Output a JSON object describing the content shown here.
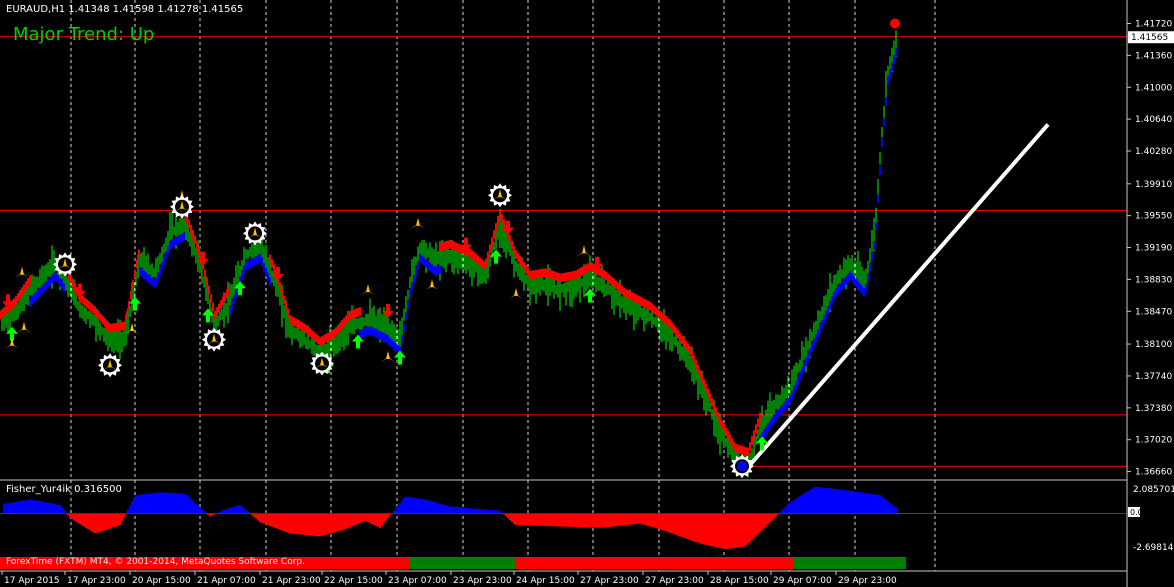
{
  "header": {
    "symbol_line": "EURAUD,H1  1.41348 1.41598 1.41278 1.41565",
    "trend_label": "Major Trend: Up"
  },
  "subwindow": {
    "title": "Fisher_Yur4ik 0.316500",
    "scale_top": "2.085701",
    "scale_zero": "0.00",
    "scale_bottom": "-2.698147"
  },
  "footer": {
    "copyright": "ForexTime (FXTM) MT4, © 2001-2014, MetaQuotes Software Corp."
  },
  "colors": {
    "background": "#000000",
    "bull_candle": "#00ff00",
    "bear_candle": "#00ff00",
    "trend_up": "#0000ff",
    "trend_down": "#ff0000",
    "fisher_up": "#0000ff",
    "fisher_down": "#ff0000",
    "hline": "#ff0000",
    "trendline": "#ffffff",
    "arrow_up": "#00ff00",
    "arrow_down": "#ff0000",
    "fractal": "#ffbf00",
    "text": "#ffffff",
    "trend_text": "#00d000"
  },
  "chart_data": {
    "type": "candlestick",
    "symbol": "EURAUD",
    "timeframe": "H1",
    "last_price": "1.41565",
    "y_ticks": [
      "1.41720",
      "1.41360",
      "1.41000",
      "1.40640",
      "1.40280",
      "1.39910",
      "1.39550",
      "1.39190",
      "1.38830",
      "1.38470",
      "1.38100",
      "1.37740",
      "1.37380",
      "1.37020",
      "1.36660"
    ],
    "ylim": [
      1.3661,
      1.4185
    ],
    "x_labels": [
      "17 Apr 2015",
      "17 Apr 23:00",
      "20 Apr 15:00",
      "21 Apr 07:00",
      "21 Apr 23:00",
      "22 Apr 15:00",
      "23 Apr 07:00",
      "23 Apr 23:00",
      "24 Apr 15:00",
      "27 Apr 23:00",
      "27 Apr 23:00",
      "28 Apr 15:00",
      "29 Apr 07:00",
      "29 Apr 23:00"
    ],
    "horizontal_levels": [
      1.3961,
      1.4157,
      1.373,
      1.3672
    ],
    "close_profile": [
      [
        0,
        1.383
      ],
      [
        15,
        1.3845
      ],
      [
        30,
        1.387
      ],
      [
        55,
        1.39
      ],
      [
        65,
        1.3885
      ],
      [
        80,
        1.385
      ],
      [
        95,
        1.3835
      ],
      [
        110,
        1.3815
      ],
      [
        125,
        1.3818
      ],
      [
        140,
        1.3905
      ],
      [
        155,
        1.389
      ],
      [
        170,
        1.3935
      ],
      [
        185,
        1.3945
      ],
      [
        200,
        1.39
      ],
      [
        215,
        1.383
      ],
      [
        230,
        1.386
      ],
      [
        245,
        1.391
      ],
      [
        260,
        1.392
      ],
      [
        275,
        1.388
      ],
      [
        290,
        1.3825
      ],
      [
        305,
        1.3815
      ],
      [
        320,
        1.38
      ],
      [
        335,
        1.381
      ],
      [
        350,
        1.383
      ],
      [
        370,
        1.3838
      ],
      [
        385,
        1.383
      ],
      [
        400,
        1.3815
      ],
      [
        410,
        1.388
      ],
      [
        420,
        1.392
      ],
      [
        435,
        1.3905
      ],
      [
        450,
        1.391
      ],
      [
        470,
        1.39
      ],
      [
        485,
        1.3885
      ],
      [
        500,
        1.3945
      ],
      [
        515,
        1.39
      ],
      [
        530,
        1.3875
      ],
      [
        545,
        1.3878
      ],
      [
        560,
        1.3872
      ],
      [
        575,
        1.3875
      ],
      [
        590,
        1.3885
      ],
      [
        605,
        1.3875
      ],
      [
        625,
        1.3855
      ],
      [
        650,
        1.384
      ],
      [
        670,
        1.382
      ],
      [
        690,
        1.379
      ],
      [
        705,
        1.375
      ],
      [
        720,
        1.371
      ],
      [
        735,
        1.368
      ],
      [
        748,
        1.3675
      ],
      [
        760,
        1.3715
      ],
      [
        775,
        1.374
      ],
      [
        790,
        1.376
      ],
      [
        805,
        1.38
      ],
      [
        820,
        1.384
      ],
      [
        835,
        1.388
      ],
      [
        850,
        1.39
      ],
      [
        865,
        1.388
      ],
      [
        875,
        1.394
      ],
      [
        882,
        1.405
      ],
      [
        888,
        1.412
      ],
      [
        893,
        1.414
      ],
      [
        897,
        1.4157
      ]
    ],
    "trend_segments": [
      {
        "from": 0,
        "to": 30,
        "dir": "down"
      },
      {
        "from": 30,
        "to": 65,
        "dir": "up"
      },
      {
        "from": 65,
        "to": 140,
        "dir": "down"
      },
      {
        "from": 140,
        "to": 185,
        "dir": "up"
      },
      {
        "from": 185,
        "to": 230,
        "dir": "down"
      },
      {
        "from": 230,
        "to": 270,
        "dir": "up"
      },
      {
        "from": 270,
        "to": 360,
        "dir": "down"
      },
      {
        "from": 360,
        "to": 400,
        "dir": "up"
      },
      {
        "from": 400,
        "to": 440,
        "dir": "up"
      },
      {
        "from": 440,
        "to": 760,
        "dir": "down"
      },
      {
        "from": 760,
        "to": 897,
        "dir": "up"
      }
    ],
    "trendline": {
      "from": [
        748,
        1.3671
      ],
      "to": [
        1048,
        1.4058
      ]
    },
    "up_arrows": [
      12,
      135,
      208,
      240,
      328,
      358,
      400,
      496,
      590,
      762
    ],
    "down_arrows": [
      8,
      80,
      203,
      278,
      388,
      466,
      508,
      597
    ],
    "fractals_up": [
      22,
      182,
      368,
      418,
      500,
      584
    ],
    "fractals_down": [
      12,
      24,
      132,
      212,
      388,
      432,
      516
    ],
    "star_markers": [
      [
        65,
        1.39
      ],
      [
        110,
        1.3786
      ],
      [
        182,
        1.3965
      ],
      [
        214,
        1.3815
      ],
      [
        255,
        1.3935
      ],
      [
        322,
        1.3788
      ],
      [
        500,
        1.3978
      ],
      [
        742,
        1.3672
      ]
    ],
    "red_dot": [
      895,
      1.4172
    ],
    "blue_dot": [
      742,
      1.3672
    ],
    "fisher_profile": [
      [
        5,
        0.7
      ],
      [
        30,
        1.0
      ],
      [
        60,
        0.6
      ],
      [
        70,
        -0.3
      ],
      [
        95,
        -1.4
      ],
      [
        120,
        -0.8
      ],
      [
        135,
        1.3
      ],
      [
        160,
        1.5
      ],
      [
        185,
        1.4
      ],
      [
        200,
        0.4
      ],
      [
        210,
        -0.2
      ],
      [
        225,
        0.3
      ],
      [
        240,
        0.6
      ],
      [
        260,
        -0.6
      ],
      [
        290,
        -1.4
      ],
      [
        320,
        -1.6
      ],
      [
        345,
        -1.1
      ],
      [
        365,
        -0.5
      ],
      [
        380,
        -1.0
      ],
      [
        395,
        0.3
      ],
      [
        405,
        1.2
      ],
      [
        425,
        1.0
      ],
      [
        450,
        0.5
      ],
      [
        500,
        0.2
      ],
      [
        515,
        -0.8
      ],
      [
        560,
        -0.9
      ],
      [
        600,
        -1.0
      ],
      [
        640,
        -0.7
      ],
      [
        660,
        -1.1
      ],
      [
        700,
        -2.1
      ],
      [
        725,
        -2.5
      ],
      [
        745,
        -2.3
      ],
      [
        770,
        -0.6
      ],
      [
        790,
        0.8
      ],
      [
        815,
        1.9
      ],
      [
        840,
        1.7
      ],
      [
        880,
        1.3
      ],
      [
        897,
        0.35
      ]
    ],
    "fisher_ylim": [
      -2.698147,
      2.085701
    ],
    "bottom_bar": [
      {
        "from": 0,
        "to": 410,
        "color": "#ff0000"
      },
      {
        "from": 410,
        "to": 516,
        "color": "#008000"
      },
      {
        "from": 516,
        "to": 793,
        "color": "#ff0000"
      },
      {
        "from": 793,
        "to": 906,
        "color": "#008000"
      }
    ]
  }
}
